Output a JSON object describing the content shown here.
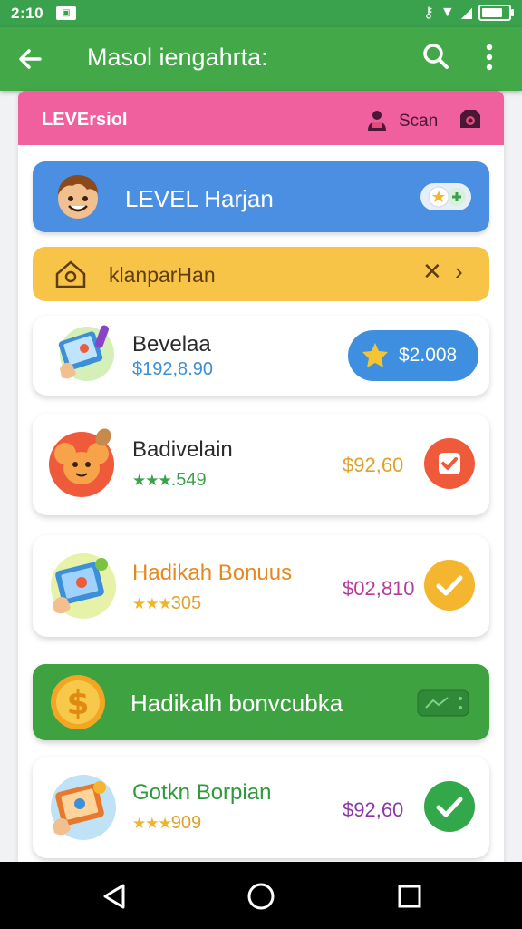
{
  "status_bar": {
    "time": "2:10",
    "notification_icon": "app-notification-icon",
    "icons": [
      "key-icon",
      "wifi-icon",
      "signal-icon"
    ],
    "battery_level": 0.9
  },
  "app_bar": {
    "title": "Masol iengahrta:",
    "back_icon": "arrow-left-icon",
    "search_icon": "search-icon",
    "more_icon": "more-vert-icon"
  },
  "panel_header": {
    "label": "LEVErsioI",
    "scan_label": "Scan",
    "person_icon": "person-icon",
    "badge_icon": "badge-icon"
  },
  "level_bar": {
    "text": "LEVEL Harjan",
    "toggle_icon": "toggle-icon"
  },
  "yellow_bar": {
    "text": "klanparHan",
    "close_glyph": "✕",
    "chevron_glyph": "›"
  },
  "items": [
    {
      "name": "Bevelaa",
      "sub": "$192,8.90",
      "button_label": "$2.008",
      "button_icon": "star-icon"
    },
    {
      "name": "Badivelain",
      "stars": "★★★",
      "rating": ".549",
      "price": "$92,60",
      "action_icon": "check-icon"
    },
    {
      "name": "Hadikah Bonuus",
      "stars": "★★★",
      "rating": "305",
      "price": "$02,810",
      "action_icon": "check-icon"
    },
    {
      "name": "Gotkn Borpian",
      "stars": "★★★",
      "rating": "909",
      "price": "$92,60",
      "action_icon": "check-icon"
    }
  ],
  "bonus_bar": {
    "text": "Hadikalh bonvcubka",
    "coin_icon": "dollar-coin-icon",
    "wallet_icon": "wallet-icon"
  },
  "nav_bar": {
    "back": "nav-back-icon",
    "home": "nav-home-icon",
    "recents": "nav-recents-icon"
  },
  "colors": {
    "green": "#43a848",
    "pink": "#f0609f",
    "blue": "#4a8fe2",
    "yellow": "#f7c448",
    "orange_red": "#ef5a3a",
    "gold": "#f3b62e",
    "check_green": "#33a84a"
  }
}
